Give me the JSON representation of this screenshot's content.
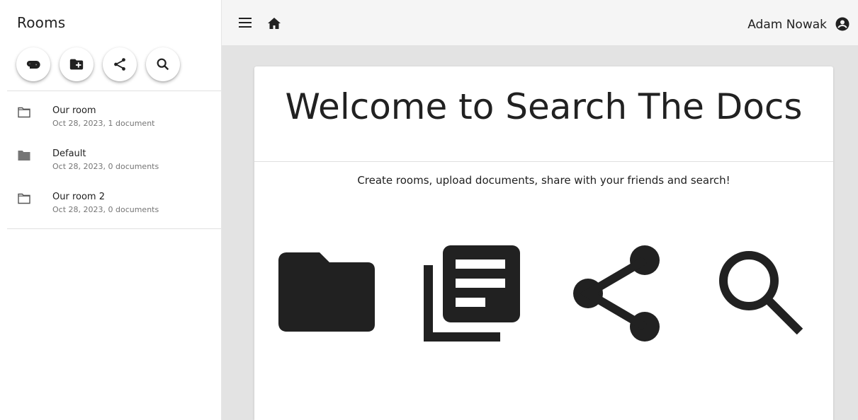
{
  "sidebar": {
    "title": "Rooms",
    "actions": [
      {
        "name": "attach",
        "icon": "paperclip-icon"
      },
      {
        "name": "new-room",
        "icon": "create-folder-icon"
      },
      {
        "name": "share",
        "icon": "share-icon"
      },
      {
        "name": "search",
        "icon": "search-icon"
      }
    ],
    "rooms": [
      {
        "name": "Our room",
        "meta": "Oct 28, 2023, 1 document",
        "icon": "folder-outline-icon"
      },
      {
        "name": "Default",
        "meta": "Oct 28, 2023, 0 documents",
        "icon": "folder-filled-icon"
      },
      {
        "name": "Our room 2",
        "meta": "Oct 28, 2023, 0 documents",
        "icon": "folder-outline-icon"
      }
    ]
  },
  "header": {
    "menu_icon": "hamburger-menu-icon",
    "home_icon": "home-icon",
    "user_name": "Adam Nowak",
    "user_icon": "account-circle-icon"
  },
  "welcome": {
    "title": "Welcome to Search The Docs",
    "subtitle": "Create rooms, upload documents, share with your friends and search!",
    "features": [
      "folder-icon",
      "documents-icon",
      "share-icon",
      "search-icon"
    ]
  },
  "colors": {
    "text": "#212121",
    "header_bg": "#f5f5f5",
    "main_bg": "#e3e3e3",
    "card_bg": "#ffffff",
    "muted_text": "#757575"
  }
}
